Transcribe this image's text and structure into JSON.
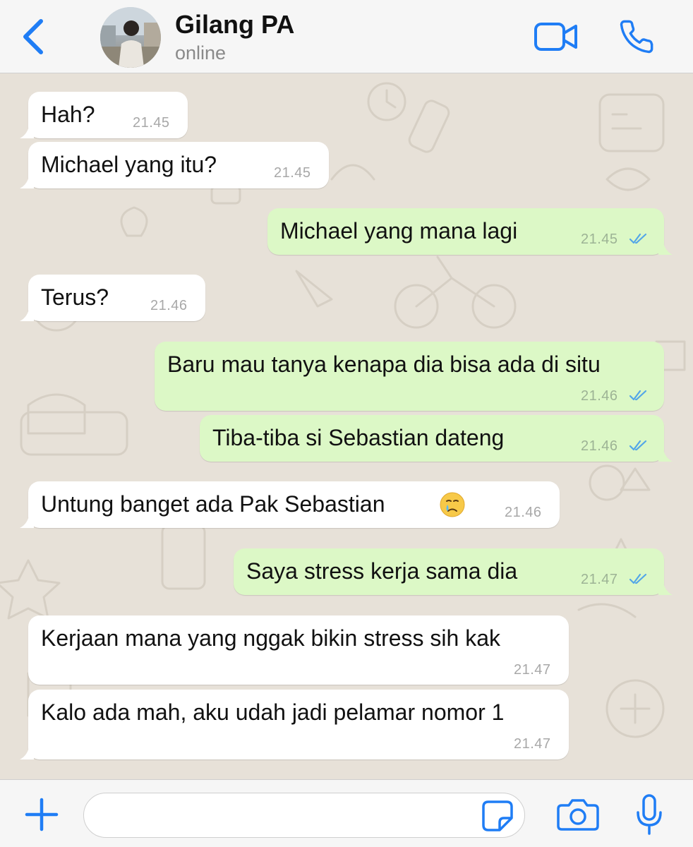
{
  "header": {
    "contact_name": "Gilang PA",
    "status": "online"
  },
  "theme": {
    "accent": "#1f7df5",
    "incoming_bubble": "#ffffff",
    "outgoing_bubble": "#dcf8c6",
    "read_ticks": "#53a6e8",
    "wallpaper": "#e7e1d8"
  },
  "messages": [
    {
      "direction": "in",
      "text": "Hah?",
      "time": "21.45"
    },
    {
      "direction": "in",
      "text": "Michael yang itu?",
      "time": "21.45"
    },
    {
      "direction": "out",
      "text": "Michael yang mana lagi",
      "time": "21.45",
      "status": "read"
    },
    {
      "direction": "in",
      "text": "Terus?",
      "time": "21.46"
    },
    {
      "direction": "out",
      "text": "Baru mau tanya kenapa dia bisa ada di situ",
      "time": "21.46",
      "status": "read"
    },
    {
      "direction": "out",
      "text": "Tiba-tiba si Sebastian dateng",
      "time": "21.46",
      "status": "read"
    },
    {
      "direction": "in",
      "text": "Untung banget ada Pak Sebastian",
      "emoji": "sad-relieved-face",
      "time": "21.46"
    },
    {
      "direction": "out",
      "text": "Saya stress kerja sama dia",
      "time": "21.47",
      "status": "read"
    },
    {
      "direction": "in",
      "text": "Kerjaan mana yang nggak bikin stress sih kak",
      "time": "21.47"
    },
    {
      "direction": "in",
      "text": "Kalo ada mah, aku udah jadi pelamar nomor 1",
      "time": "21.47"
    }
  ],
  "composer": {
    "placeholder": "",
    "icons": [
      "plus-icon",
      "sticker-icon",
      "camera-icon",
      "microphone-icon"
    ]
  }
}
